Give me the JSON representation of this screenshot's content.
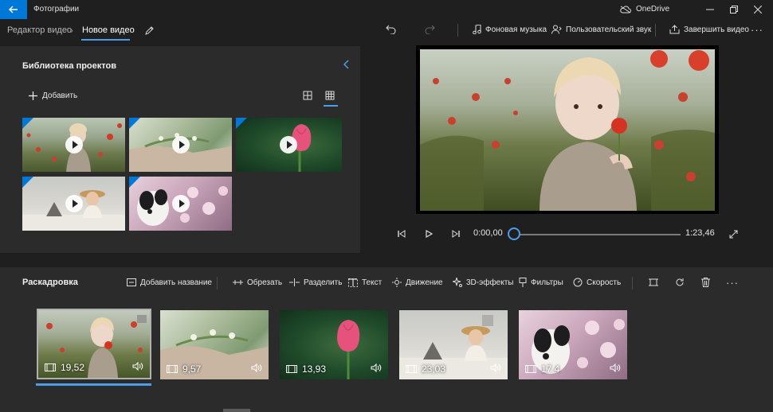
{
  "titlebar": {
    "app_title": "Фотографии",
    "onedrive": "OneDrive"
  },
  "breadcrumb": {
    "parent": "Редактор видео",
    "current": "Новое видео"
  },
  "toolbar": {
    "background_music": "Фоновая музыка",
    "custom_audio": "Пользовательский звук",
    "finish_video": "Завершить видео"
  },
  "library": {
    "title": "Библиотека проектов",
    "add_label": "Добавить"
  },
  "player": {
    "current_time": "0:00,00",
    "total_time": "1:23,46",
    "progress": 0
  },
  "storyboard": {
    "title": "Раскадровка",
    "actions": {
      "add_title": "Добавить название",
      "trim": "Обрезать",
      "split": "Разделить",
      "text": "Текст",
      "motion": "Движение",
      "effects_3d": "3D-эффекты",
      "filters": "Фильтры",
      "speed": "Скорость"
    },
    "clips": [
      {
        "duration": "19,52"
      },
      {
        "duration": "9,57"
      },
      {
        "duration": "13,93"
      },
      {
        "duration": "23,03"
      },
      {
        "duration": "17,4"
      }
    ]
  },
  "colors": {
    "accent": "#0078d7",
    "accent_light": "#4c9eea"
  }
}
